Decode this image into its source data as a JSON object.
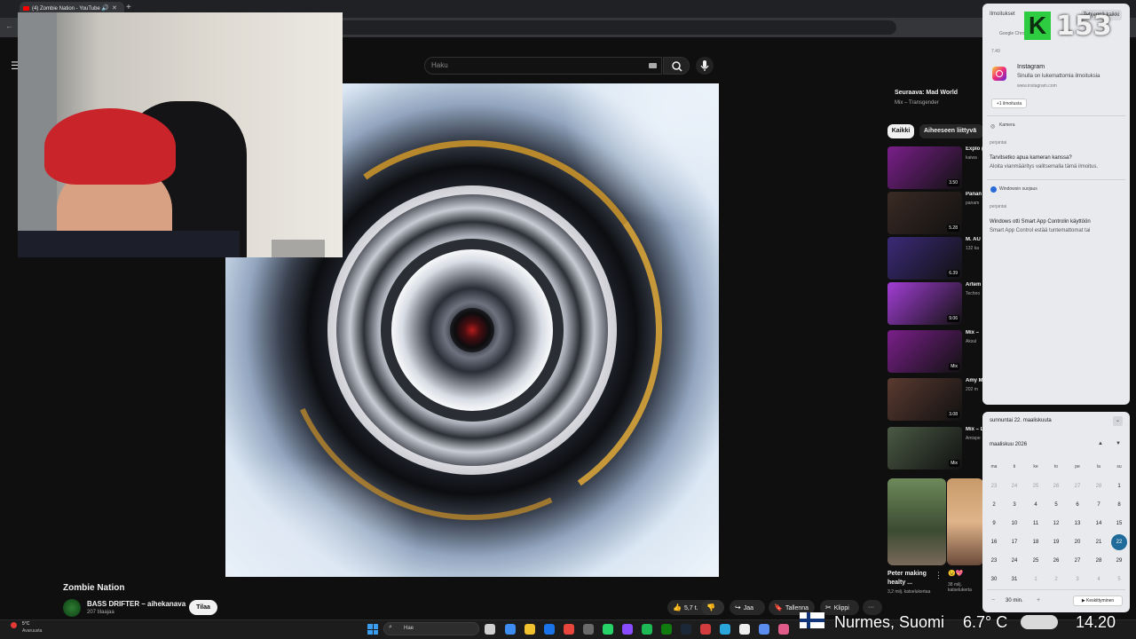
{
  "browser": {
    "tab_title": "(4) Zombie Nation - YouTube",
    "new_tab_label": "+"
  },
  "youtube": {
    "search_placeholder": "Haku",
    "video_title": "Zombie Nation",
    "channel_name": "BASS DRIFTER – aihekanava",
    "subscribers": "207 tilaajaa",
    "subscribe_label": "Tilaa",
    "actions": {
      "likes": "5,7 t.",
      "share": "Jaa",
      "save": "Tallenna",
      "clip": "Klippi",
      "more": "···"
    },
    "up_next": {
      "title": "Seuraava: Mad World",
      "subtitle": "Mix – Transgender"
    },
    "chips": [
      "Kaikki",
      "Aiheeseen liittyvä"
    ],
    "recommendations": [
      {
        "title": "Explo (Exter",
        "meta": "kaiwa",
        "badge": "3.50",
        "color": "#7a1f8a"
      },
      {
        "title": "Panan menn",
        "meta": "panam",
        "badge": "5.28",
        "color": "#3a2a24"
      },
      {
        "title": "M. AU",
        "meta": "132 ka",
        "badge": "6.39",
        "color": "#3b2a78"
      },
      {
        "title": "Artem me (T",
        "meta": "Techno",
        "badge": "9.06",
        "color": "#a33ed6"
      },
      {
        "title": "Mix –",
        "meta": "Aksul",
        "badge": "Mix",
        "color": "#7a1f8a"
      },
      {
        "title": "Amy M Life",
        "meta": "202 m",
        "badge": "3.08",
        "color": "#5a3a30"
      },
      {
        "title": "Mix – Do",
        "meta": "Amispe",
        "badge": "Mix",
        "color": "#4a5a44"
      }
    ],
    "shorts": [
      {
        "title": "Peter making healty ...",
        "meta": "3,2 milj. katselukertaa"
      },
      {
        "title": "😉💖",
        "meta": "38 milj. katselukerta"
      }
    ]
  },
  "stream_overlay": {
    "k_logo": "K",
    "viewer_count": "153",
    "location": "Nurmes, Suomi",
    "temperature": "6.7° C",
    "clock": "14.20"
  },
  "notifications": {
    "header": "Ilmoitukset",
    "clear_all": "Tyhjennä kaikki",
    "google_source": "Google Chrome",
    "time": "7.49",
    "instagram": {
      "title": "Instagram",
      "text": "Sinulla on lukemattomia ilmoituksia",
      "url": "www.instagram.com",
      "more": "+1 ilmoitusta"
    },
    "camera": {
      "label": "Kamera",
      "day": "perjantai",
      "title": "Tarvitsetko apua kameran kanssa?",
      "text": "Aloita vianmääritys valitsemalla tämä ilmoitus."
    },
    "security": {
      "label": "Windowsin suojaus",
      "day": "perjantai",
      "title": "Windows otti Smart App Controlin käyttöön",
      "text": "Smart App Control estää tuntemattomat tai"
    }
  },
  "calendar": {
    "date_header": "sunnuntai 22. maaliskuuta",
    "month": "maaliskuu 2026",
    "weekdays": [
      "ma",
      "ti",
      "ke",
      "to",
      "pe",
      "la",
      "su"
    ],
    "days": [
      [
        "23",
        "24",
        "25",
        "26",
        "27",
        "28",
        "1"
      ],
      [
        "2",
        "3",
        "4",
        "5",
        "6",
        "7",
        "8"
      ],
      [
        "9",
        "10",
        "11",
        "12",
        "13",
        "14",
        "15"
      ],
      [
        "16",
        "17",
        "18",
        "19",
        "20",
        "21",
        "22"
      ],
      [
        "23",
        "24",
        "25",
        "26",
        "27",
        "28",
        "29"
      ],
      [
        "30",
        "31",
        "1",
        "2",
        "3",
        "4",
        "5"
      ]
    ],
    "today": "22",
    "focus_minutes": "30 min.",
    "focus_button": "Keskittyminen"
  },
  "taskbar": {
    "weather_temp": "5°C",
    "weather_desc": "Avaruusta",
    "search_placeholder": "Hae",
    "apps": [
      {
        "name": "task-view-icon",
        "color": "#d0d0d0"
      },
      {
        "name": "copilot-icon",
        "color": "#3f8cf0"
      },
      {
        "name": "file-explorer-icon",
        "color": "#f2c12e"
      },
      {
        "name": "outlook-icon",
        "color": "#1a73e8"
      },
      {
        "name": "chrome-icon",
        "color": "#e8453c"
      },
      {
        "name": "obs-icon",
        "color": "#6a6a6a"
      },
      {
        "name": "whatsapp-icon",
        "color": "#25d366"
      },
      {
        "name": "messenger-icon",
        "color": "#8a4cff"
      },
      {
        "name": "spotify-icon",
        "color": "#1db954"
      },
      {
        "name": "xbox-icon",
        "color": "#107c10"
      },
      {
        "name": "steam-icon",
        "color": "#1b2838"
      },
      {
        "name": "game-icon",
        "color": "#d23c3c"
      },
      {
        "name": "edge-icon",
        "color": "#2aa6da"
      },
      {
        "name": "capcut-icon",
        "color": "#eeeeee"
      },
      {
        "name": "photos-icon",
        "color": "#5b8def"
      },
      {
        "name": "snipping-icon",
        "color": "#e05a8a"
      }
    ]
  }
}
